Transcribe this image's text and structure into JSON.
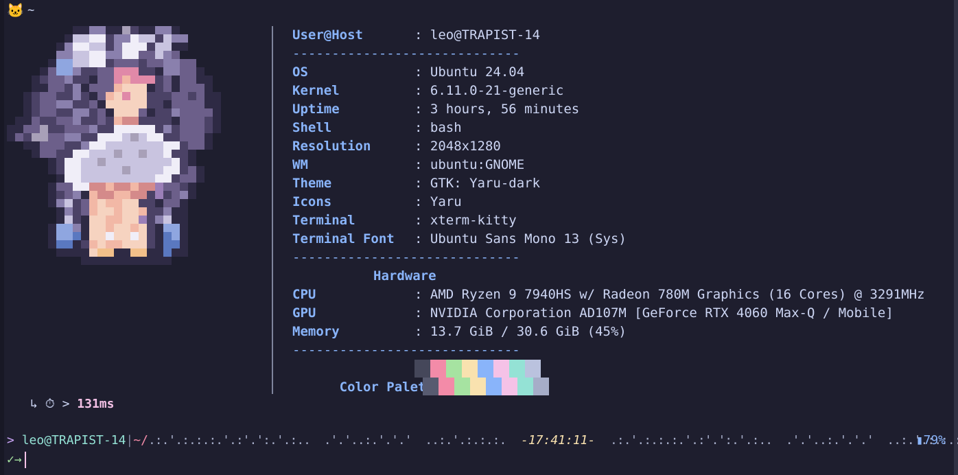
{
  "tab": {
    "icon": "cat-icon",
    "glyph": "🐱",
    "title": "~"
  },
  "sysinfo": {
    "header": {
      "key": "User@Host",
      "value": "leo@TRAPIST-14"
    },
    "separator": "-----------------------------",
    "rows": [
      {
        "key": "OS",
        "value": "Ubuntu 24.04"
      },
      {
        "key": "Kernel",
        "value": "6.11.0-21-generic"
      },
      {
        "key": "Uptime",
        "value": "3 hours, 56 minutes"
      },
      {
        "key": "Shell",
        "value": "bash"
      },
      {
        "key": "Resolution",
        "value": "2048x1280"
      },
      {
        "key": "WM",
        "value": "ubuntu:GNOME"
      },
      {
        "key": "Theme",
        "value": "GTK: Yaru-dark"
      },
      {
        "key": "Icons",
        "value": "Yaru"
      },
      {
        "key": "Terminal",
        "value": "xterm-kitty"
      },
      {
        "key": "Terminal Font",
        "value": "Ubuntu Sans Mono 13 (Sys)"
      }
    ],
    "hardware_title": "Hardware",
    "hardware": [
      {
        "key": "CPU",
        "value": "AMD Ryzen 9 7940HS w/ Radeon 780M Graphics (16 Cores) @ 3291MHz"
      },
      {
        "key": "GPU",
        "value": "NVIDIA Corporation AD107M [GeForce RTX 4060 Max-Q / Mobile]"
      },
      {
        "key": "Memory",
        "value": "13.7 GiB / 30.6 GiB (45%)"
      }
    ],
    "palette_label": "Color Palette",
    "palette_top": [
      "#45475a",
      "#f38ba8",
      "#a6e3a1",
      "#f9e2af",
      "#89b4fa",
      "#f5c2e7",
      "#94e2d5",
      "#bac2de"
    ],
    "palette_bottom": [
      "#585b70",
      "#f38ba8",
      "#a6e3a1",
      "#f9e2af",
      "#89b4fa",
      "#f5c2e7",
      "#94e2d5",
      "#a6adc8"
    ]
  },
  "timer": {
    "arrow": "↳",
    "icon": "stopwatch-icon",
    "glyph": "⏱",
    "gt": ">",
    "duration": "131ms"
  },
  "prompt": {
    "marker": ">",
    "user_host": "leo@TRAPIST-14",
    "pipe": "|",
    "cwd": "~/",
    "dots_left": ".:.'.:.:.:.'.:'.':.'.:..  .'.'..:.'.'.'  ..:.'.:.:.:.",
    "time": "-17:41:11-",
    "dots_right": ".:.'.:.:.:.'.:'.':.'.:..  .'.'..:.'.'.'  ..:.'.:.:.:.",
    "battery_icon": "battery-icon",
    "battery": "79%",
    "input_marker": "✓→"
  }
}
